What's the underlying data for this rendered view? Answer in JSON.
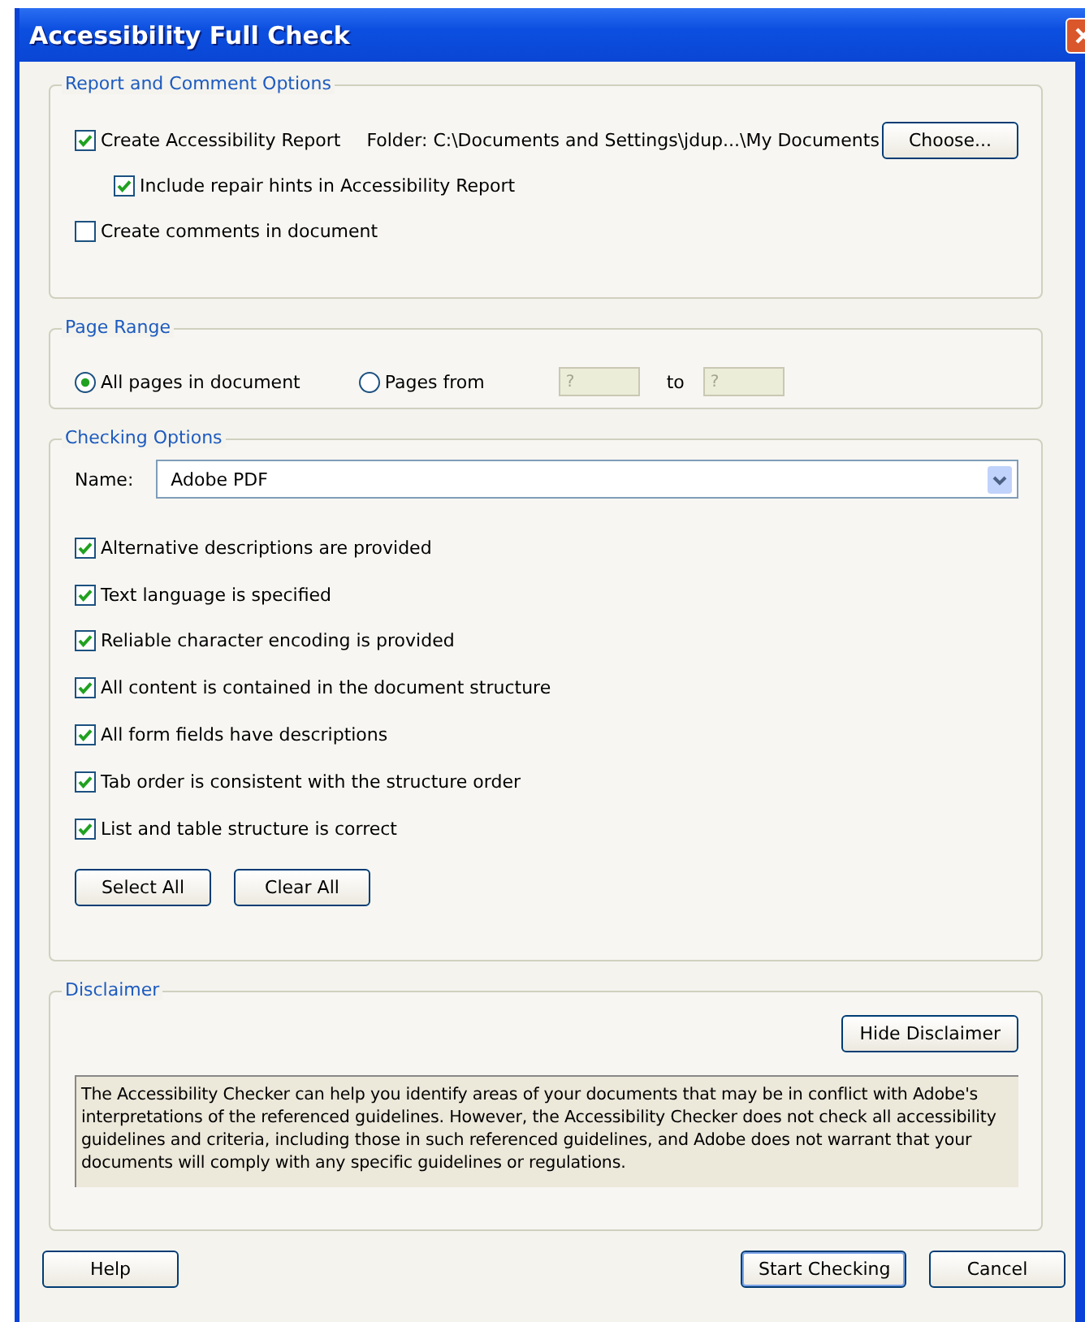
{
  "window": {
    "title": "Accessibility Full Check"
  },
  "report_options": {
    "title": "Report and Comment Options",
    "items": [
      {
        "label": "Create Accessibility Report",
        "checked": true,
        "folder": "Folder: C:\\Documents and Settings\\jdup...\\My Documents",
        "button": "Choose...",
        "children": [
          {
            "label": "Include repair hints in Accessibility Report",
            "checked": true
          }
        ]
      },
      {
        "label": "Create comments in document",
        "checked": false
      }
    ]
  },
  "page_range": {
    "title": "Page Range",
    "options": [
      {
        "label": "All pages in document",
        "selected": true
      },
      {
        "label": "Pages from",
        "selected": false,
        "from_value": "?",
        "to_label": "to",
        "to_value": "?",
        "disabled": true
      }
    ]
  },
  "checking_options": {
    "title": "Checking Options",
    "name_label": "Name:",
    "name_value": "Adobe PDF",
    "checks": [
      {
        "label": "Alternative descriptions are provided",
        "checked": true
      },
      {
        "label": "Text language is specified",
        "checked": true
      },
      {
        "label": "Reliable character encoding is provided",
        "checked": true
      },
      {
        "label": "All content is contained in the document structure",
        "checked": true
      },
      {
        "label": "All form fields have descriptions",
        "checked": true
      },
      {
        "label": "Tab order is consistent with the structure order",
        "checked": true
      },
      {
        "label": "List and table structure is correct",
        "checked": true
      }
    ],
    "buttons": [
      "Select All",
      "Clear All"
    ]
  },
  "disclaimer": {
    "title": "Disclaimer",
    "button": "Hide Disclaimer",
    "text": "The Accessibility Checker can help you identify areas of your documents that may be in conflict with Adobe's interpretations of the referenced guidelines. However, the Accessibility Checker does not check all accessibility guidelines and criteria, including those in such referenced guidelines, and Adobe does not warrant that your documents will comply with any specific guidelines or regulations."
  },
  "footer": {
    "left": [
      {
        "label": "Help",
        "default": false
      }
    ],
    "right": [
      {
        "label": "Start Checking",
        "default": true
      },
      {
        "label": "Cancel",
        "default": false
      }
    ]
  }
}
